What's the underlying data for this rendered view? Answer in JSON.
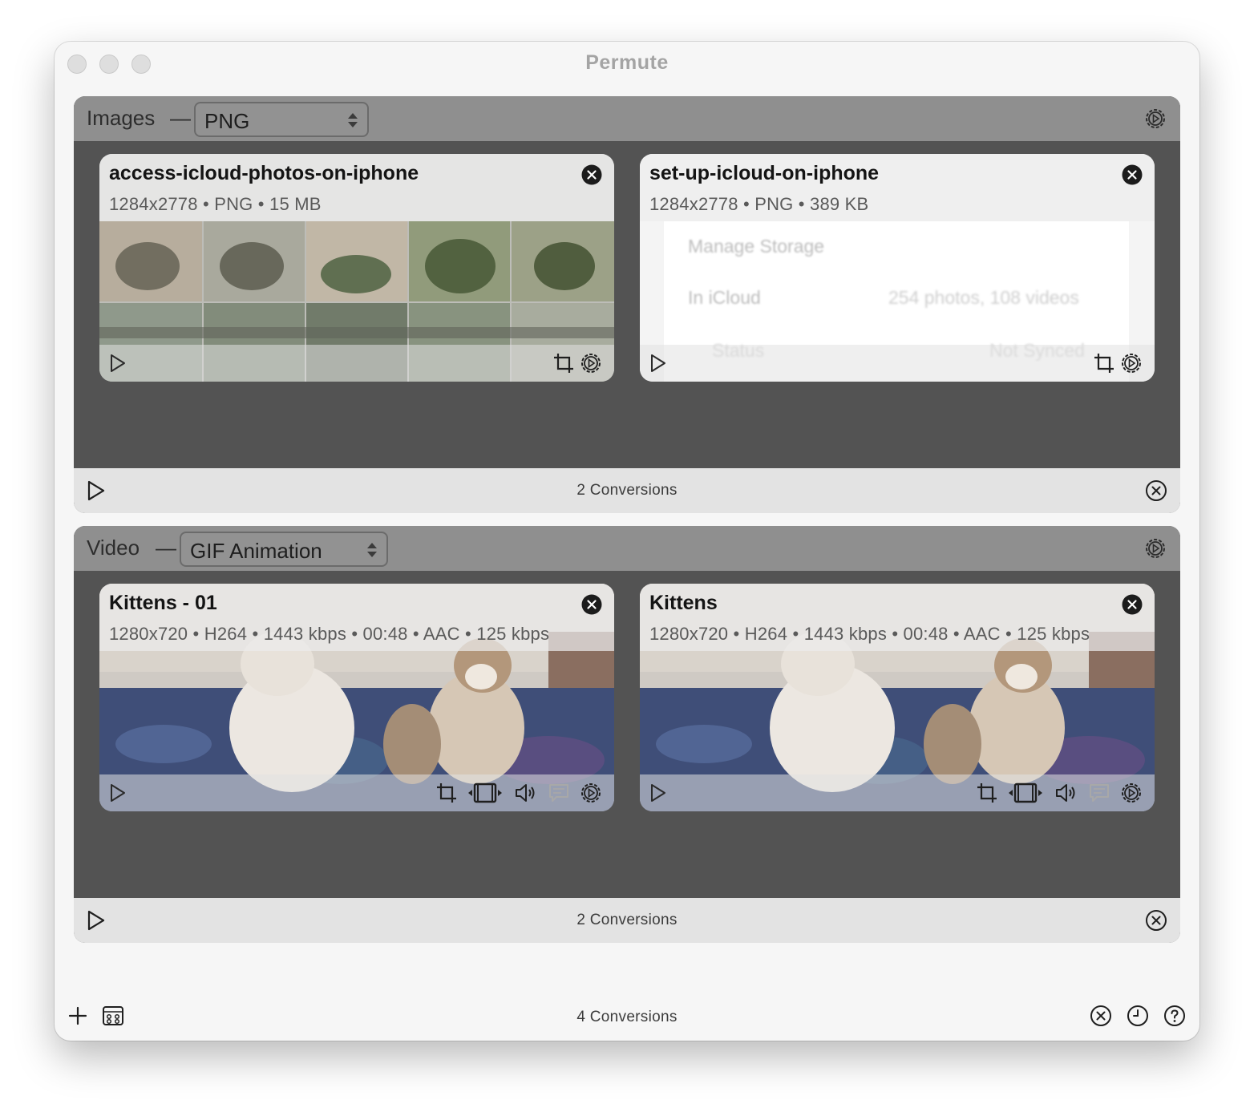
{
  "window": {
    "title": "Permute"
  },
  "sections": [
    {
      "label": "Images",
      "format": "PNG",
      "footer_count": "2 Conversions",
      "items": [
        {
          "title": "access-icloud-photos-on-iphone",
          "meta": "1284x2778 • PNG • 15 MB"
        },
        {
          "title": "set-up-icloud-on-iphone",
          "meta": "1284x2778 • PNG • 389 KB",
          "preview_text": {
            "row1_left": "Manage Storage",
            "row2_left": "In iCloud",
            "row2_right": "254 photos, 108 videos",
            "row3_left": "Status",
            "row3_right": "Not Synced"
          }
        }
      ]
    },
    {
      "label": "Video",
      "format": "GIF Animation",
      "footer_count": "2 Conversions",
      "items": [
        {
          "title": "Kittens - 01",
          "meta": "1280x720 • H264 • 1443 kbps • 00:48 • AAC • 125 kbps"
        },
        {
          "title": "Kittens",
          "meta": "1280x720 • H264 • 1443 kbps • 00:48 • AAC • 125 kbps"
        }
      ]
    }
  ],
  "bottom_bar": {
    "total_count": "4 Conversions"
  },
  "icons": {
    "traffic_lights": [
      "close-traffic-light",
      "minimize-traffic-light",
      "zoom-traffic-light"
    ],
    "section_header": "gear-icon",
    "section_footer": [
      "play-icon",
      "close-circle-icon"
    ],
    "card_image_tools": [
      "crop-icon",
      "gear-icon"
    ],
    "card_video_tools": [
      "crop-icon",
      "film-trim-icon",
      "speaker-icon",
      "subtitles-icon",
      "gear-icon"
    ],
    "bottom_left": [
      "plus-icon",
      "presets-icon"
    ],
    "bottom_right": [
      "close-circle-icon",
      "history-clock-icon",
      "help-icon"
    ]
  },
  "colors": {
    "window_bg": "#f6f6f6",
    "section_body": "#535353",
    "section_header": "#8f8f8f",
    "section_footer": "#e3e3e3"
  }
}
